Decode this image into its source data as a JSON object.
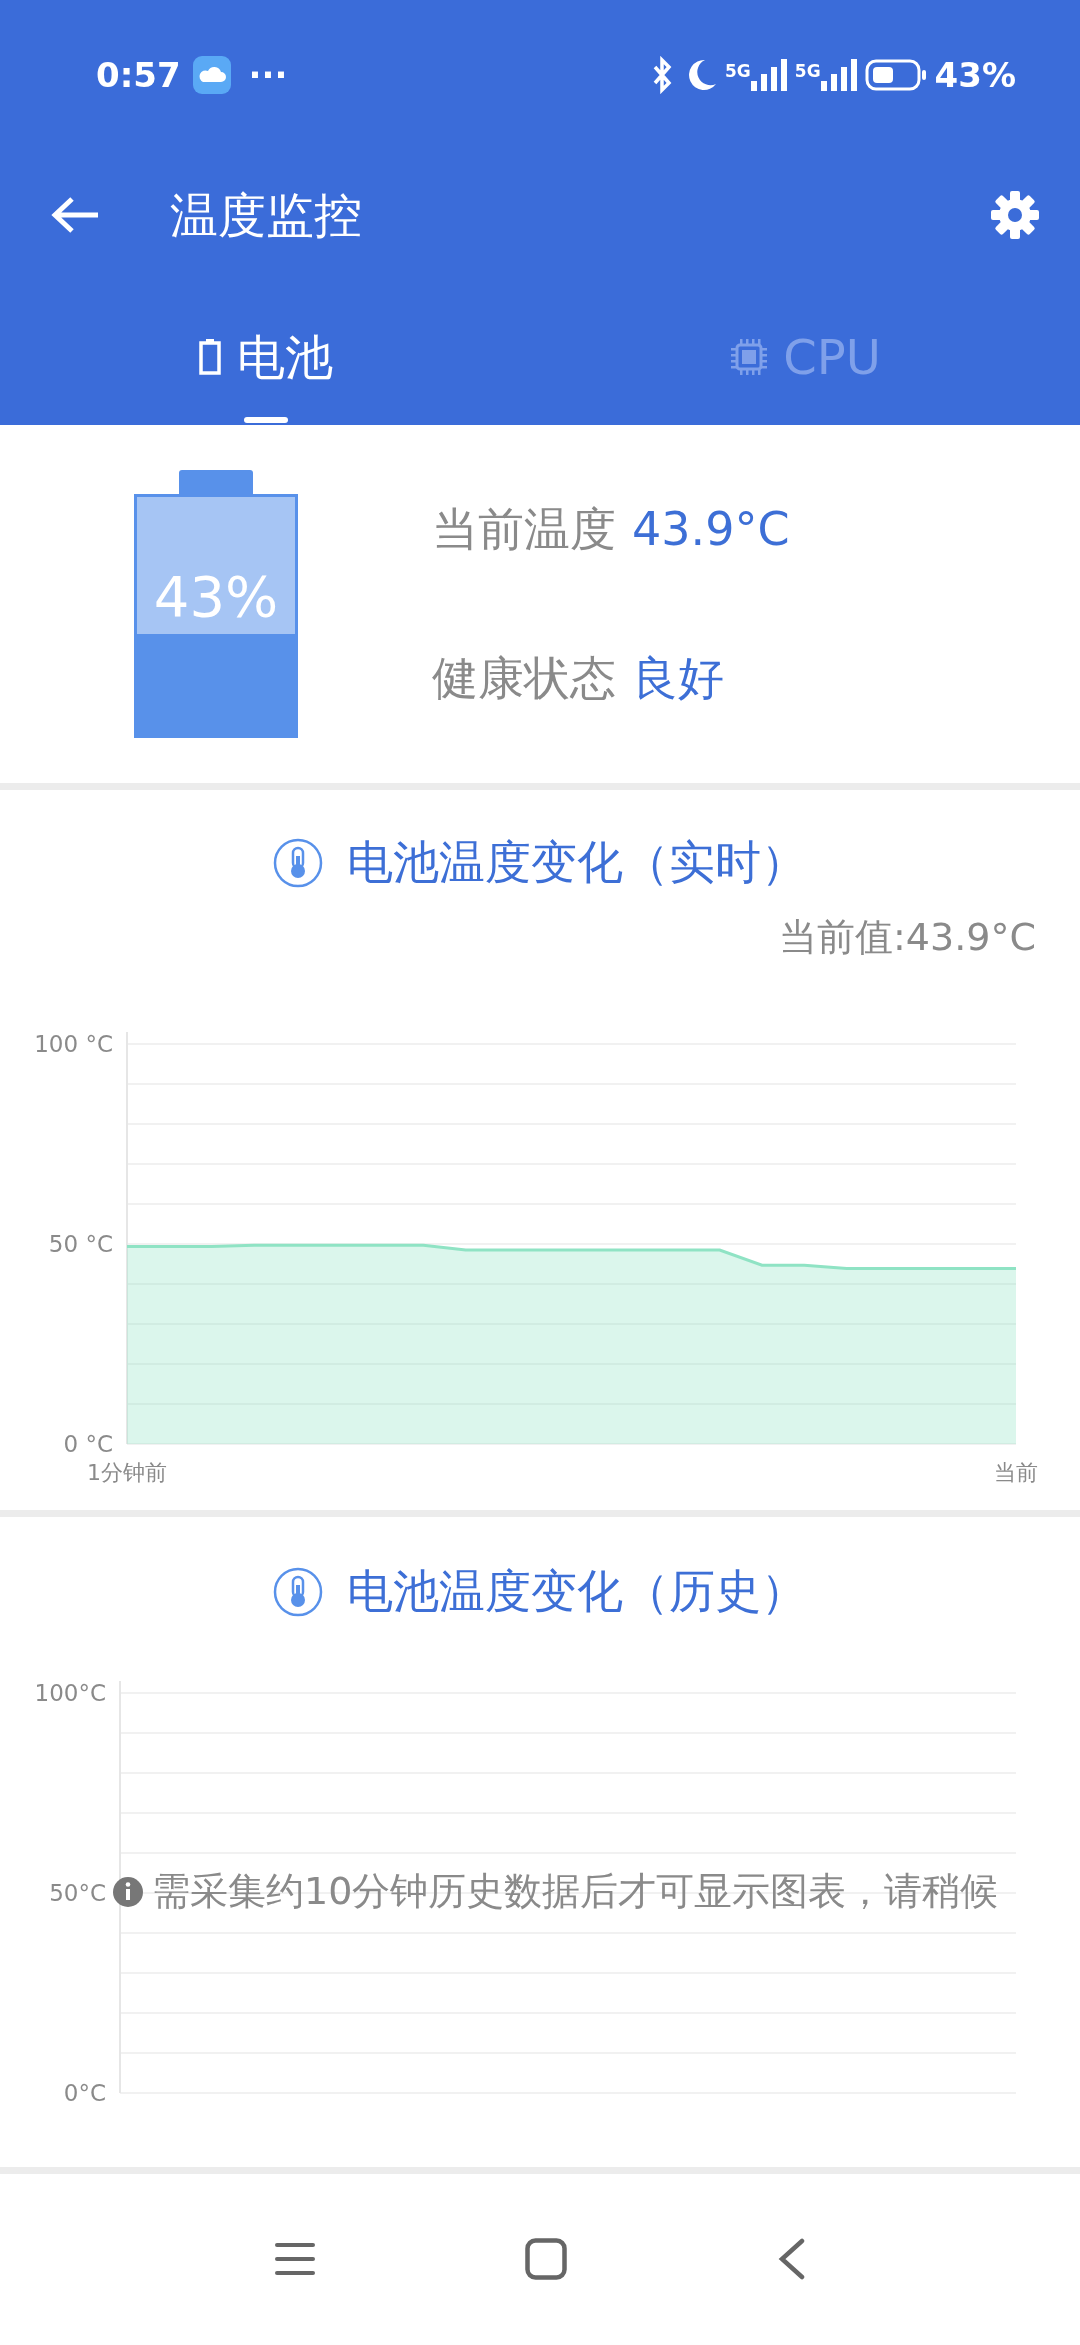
{
  "status_bar": {
    "time": "0:57",
    "more": "···",
    "network_labels": [
      "5G",
      "5G"
    ],
    "battery": "43%"
  },
  "toolbar": {
    "title": "温度监控"
  },
  "tabs": [
    {
      "label": "电池",
      "selected": true,
      "kind": "battery"
    },
    {
      "label": "CPU",
      "selected": false,
      "kind": "chip"
    }
  ],
  "battery_card": {
    "level": 0.43,
    "percent": "43%",
    "rows": [
      {
        "label": "当前温度",
        "value": "43.9°C"
      },
      {
        "label": "健康状态",
        "value": "良好"
      }
    ]
  },
  "realtime_chart": {
    "title": "电池温度变化（实时）",
    "current": "当前值:43.9°C",
    "chart_data": {
      "type": "area",
      "ylim": [
        0,
        100
      ],
      "categories": [
        "1分钟前",
        null,
        null,
        null,
        null,
        null,
        null,
        null,
        null,
        null,
        null,
        null,
        null,
        null,
        null,
        null,
        null,
        null,
        null,
        null,
        null,
        "当前"
      ],
      "yticks": [
        {
          "value": 0,
          "label": "0 °C"
        },
        {
          "value": 50,
          "label": "50 °C"
        },
        {
          "value": 100,
          "label": "100 °C"
        }
      ],
      "series": [
        {
          "color": "#8fe3c4",
          "values": [
            49.4,
            49.4,
            49.4,
            49.7,
            49.7,
            49.7,
            49.7,
            49.7,
            48.5,
            48.5,
            48.5,
            48.5,
            48.5,
            48.5,
            48.5,
            44.7,
            44.7,
            43.9,
            43.9,
            43.9,
            43.9,
            43.9
          ]
        }
      ]
    }
  },
  "history_chart": {
    "title": "电池温度变化（历史）",
    "axis_labels": [
      "100°C",
      "50°C",
      "0°C"
    ],
    "notice": "需采集约10分钟历史数据后才可显示图表，请稍候"
  }
}
